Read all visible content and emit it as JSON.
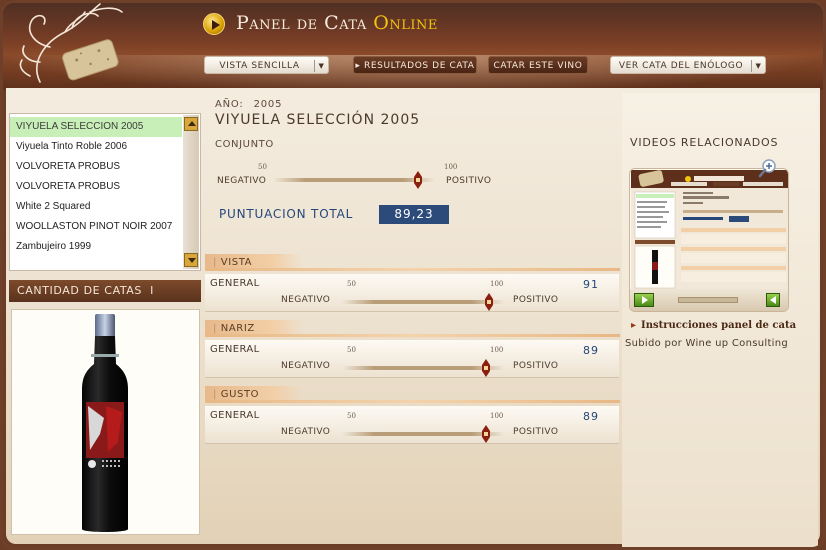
{
  "app": {
    "title_main": "Panel de Cata",
    "title_accent": "Online"
  },
  "nav": {
    "vista_sencilla": "VISTA SENCILLA",
    "resultados": "RESULTADOS DE CATA",
    "catar": "CATAR ESTE VINO",
    "enologo": "VER CATA DEL ENÓLOGO"
  },
  "wine_list": {
    "items": [
      "VIYUELA SELECCION 2005",
      "Viyuela Tinto Roble 2006",
      "VOLVORETA PROBUS",
      "VOLVORETA PROBUS",
      "White 2 Squared",
      "WOOLLASTON PINOT NOIR 2007",
      "Zambujeiro 1999"
    ],
    "selected_index": 0
  },
  "count_bar": {
    "label": "CANTIDAD DE CATAS",
    "separator": "I"
  },
  "wine": {
    "anio_label": "AÑO:",
    "anio": "2005",
    "name": "VIYUELA SELECCIÓN 2005"
  },
  "conjunto": {
    "label": "CONJUNTO",
    "tick_50": "50",
    "tick_100": "100",
    "negativo": "NEGATIVO",
    "positivo": "POSITIVO",
    "level_percent": 89.23
  },
  "total": {
    "label": "PUNTUACION TOTAL",
    "value": "89,23"
  },
  "sections": [
    {
      "title": "VISTA",
      "general": "GENERAL",
      "tick_50": "50",
      "tick_100": "100",
      "negativo": "NEGATIVO",
      "positivo": "POSITIVO",
      "score": "91",
      "level_percent": 91
    },
    {
      "title": "NARIZ",
      "general": "GENERAL",
      "tick_50": "50",
      "tick_100": "100",
      "negativo": "NEGATIVO",
      "positivo": "POSITIVO",
      "score": "89",
      "level_percent": 89
    },
    {
      "title": "GUSTO",
      "general": "GENERAL",
      "tick_50": "50",
      "tick_100": "100",
      "negativo": "NEGATIVO",
      "positivo": "POSITIVO",
      "score": "89",
      "level_percent": 89
    }
  ],
  "videos": {
    "title": "VIDEOS RELACIONADOS",
    "link": "Instrucciones panel de cata",
    "uploaded_by": "Subido por Wine up Consulting"
  },
  "colors": {
    "accent_gold": "#f1c40f",
    "header_brown": "#6b3520",
    "score_blue": "#25477a",
    "selected_green": "#c9efb9"
  },
  "icons": {
    "title": "play-circle-icon",
    "zoom": "magnifier-plus-icon",
    "video_play": "play-icon",
    "video_back": "rewind-icon"
  }
}
